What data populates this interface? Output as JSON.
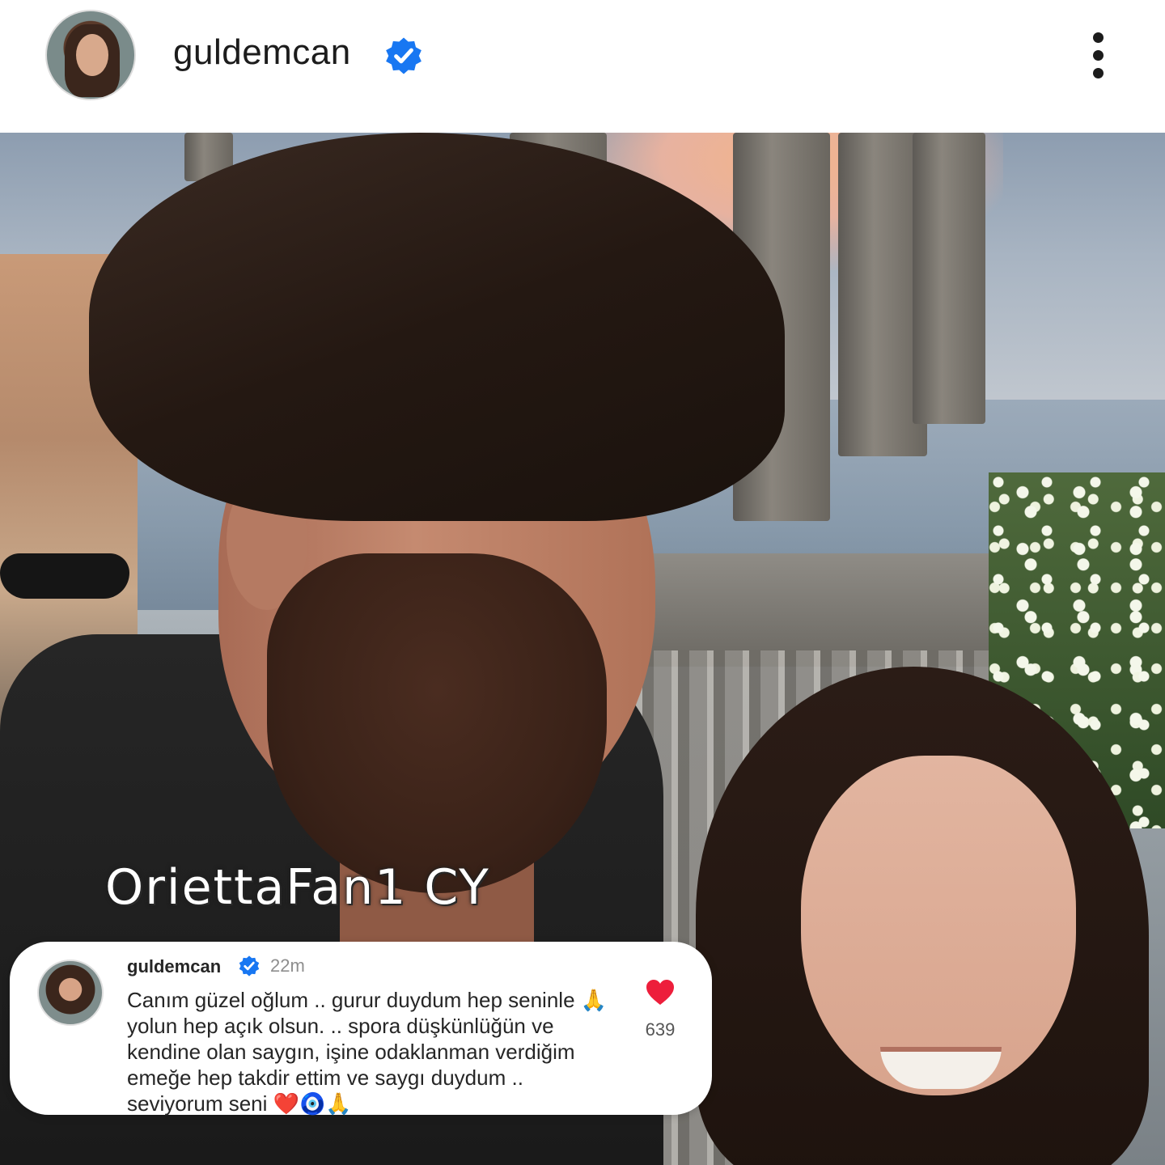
{
  "header": {
    "username": "guldemcan",
    "verified_icon": "verified-badge-icon",
    "verified_color": "#1877f2",
    "more_icon": "more-vertical-icon"
  },
  "post": {
    "watermark": "OriettaFan1 CY"
  },
  "comment": {
    "username": "guldemcan",
    "time": "22m",
    "text": "Canım güzel oğlum .. gurur duydum hep seninle 🙏 yolun hep açık olsun. .. spora düşkünlüğün ve kendine olan saygın, işine odaklanman verdiğim emeğe hep takdir ettim ve saygı duydum .. seviyorum seni ❤️🧿🙏",
    "likes": "639",
    "heart_color": "#ed1e3b",
    "heart_icon": "heart-filled-icon"
  }
}
